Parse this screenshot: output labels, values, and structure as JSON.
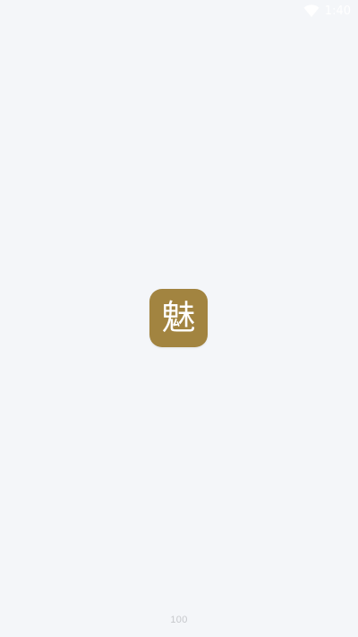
{
  "status_bar": {
    "time": "1:40",
    "wifi_icon": "wifi-icon",
    "text_color": "#ffffff"
  },
  "splash": {
    "logo_text": "魅",
    "logo_bg_color": "#a28440",
    "logo_icon": "app-logo-icon",
    "background_color": "#f4f6f9"
  },
  "footer": {
    "counter": "100",
    "counter_color": "#c6c8cc"
  }
}
